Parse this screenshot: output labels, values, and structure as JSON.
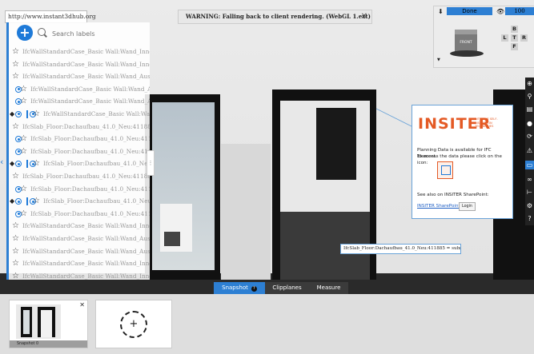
{
  "browser": {
    "url": "http://www.instant3dhub.org"
  },
  "warning": {
    "text": "WARNING: Falling back to client rendering. (WebGL 1.ext)",
    "close": "✕"
  },
  "label_panel": {
    "search_placeholder": "Search labels",
    "add_symbol": "+",
    "items": [
      {
        "text": "IfcWallStandardCase_Basic Wall:Wand_Innen_25.0_Ne",
        "indent": 0,
        "selected": false
      },
      {
        "text": "IfcWallStandardCase_Basic Wall:Wand_Innen_25.0_Ne",
        "indent": 0,
        "selected": false
      },
      {
        "text": "IfcWallStandardCase_Basic Wall:Wand_Aussen_32.5_N",
        "indent": 0,
        "selected": false
      },
      {
        "text": "IfcWallStandardCase_Basic Wall:Wand_Aussen_",
        "indent": 1,
        "selected": false
      },
      {
        "text": "IfcWallStandardCase_Basic Wall:Wand_Aussen_",
        "indent": 1,
        "selected": false
      },
      {
        "text": "IfcWallStandardCase_Basic Wall:Wand_Au",
        "indent": 2,
        "selected": true
      },
      {
        "text": "IfcSlab_Floor:Dachaufbau_41.0_Neu:411885",
        "indent": 0,
        "selected": false
      },
      {
        "text": "IfcSlab_Floor:Dachaufbau_41.0_Neu:411885",
        "indent": 1,
        "selected": false
      },
      {
        "text": "IfcSlab_Floor:Dachaufbau_41.0_Neu:411885",
        "indent": 1,
        "selected": false
      },
      {
        "text": "IfcSlab_Floor:Dachaufbau_41.0_Neu:41188",
        "indent": 2,
        "selected": true
      },
      {
        "text": "IfcSlab_Floor:Dachaufbau_41.0_Neu:411885:2",
        "indent": 0,
        "selected": false
      },
      {
        "text": "IfcSlab_Floor:Dachaufbau_41.0_Neu:411885:2",
        "indent": 1,
        "selected": false
      },
      {
        "text": "IfcSlab_Floor:Dachaufbau_41.0_Neu:41188",
        "indent": 2,
        "selected": true
      },
      {
        "text": "IfcSlab_Floor:Dachaufbau_41.0_Neu:411885:2",
        "indent": 1,
        "selected": false
      },
      {
        "text": "IfcWallStandardCase_Basic Wall:Wand_Innen_07.0_Ne",
        "indent": 0,
        "selected": false
      },
      {
        "text": "IfcWallStandardCase_Basic Wall:Wand_Aussen_Anfang",
        "indent": 0,
        "selected": false
      },
      {
        "text": "IfcWallStandardCase_Basic Wall:Wand_Aussen_Anfang",
        "indent": 0,
        "selected": false
      },
      {
        "text": "IfcWallStandardCase_Basic Wall:Wand_Innen_12.5_Ne",
        "indent": 0,
        "selected": false
      },
      {
        "text": "IfcWallStandardCase_Basic Wall:Wand_Innen_12.5_Ne",
        "indent": 0,
        "selected": false
      }
    ]
  },
  "info_popup": {
    "logo_main": "INSITER",
    "logo_tagline": "INTUITIVE SELF-INSPECTION TECHNIQUES",
    "line1": "Planning Data is available for IFC Element.",
    "line2": "To access the data please click on the icon:",
    "line3": "See also on INSITER SharePoint:",
    "sharepoint_link": "INSITER SharePoint",
    "login": "Login"
  },
  "tooltip": {
    "text": "IfcSlab_Floor:Dachaufbau_41.0_Neu:411885 = subguo = 0"
  },
  "view_controls": {
    "done": "Done",
    "zoom": "100",
    "front": "FRONT",
    "buttons": [
      "B",
      "L",
      "T",
      "R",
      "F"
    ]
  },
  "bottom_tabs": [
    {
      "label": "Snapshot",
      "active": true,
      "help": "?"
    },
    {
      "label": "Clipplanes",
      "active": false
    },
    {
      "label": "Measure",
      "active": false
    }
  ],
  "snapshots": [
    {
      "label": "Snapshot 0",
      "close": "✕"
    }
  ],
  "add_snapshot_symbol": "+",
  "colors": {
    "accent": "#2d7fd3",
    "insiter_orange": "#e45a25"
  }
}
